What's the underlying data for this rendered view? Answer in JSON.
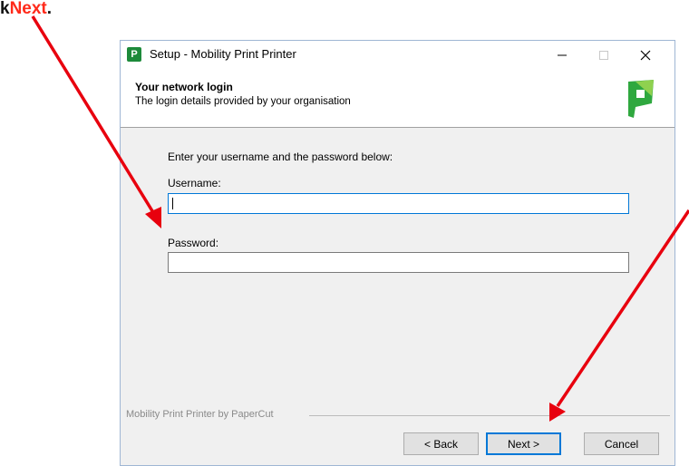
{
  "callout": {
    "prefix": "k ",
    "highlight": "Next",
    "suffix": "."
  },
  "window": {
    "title": "Setup - Mobility Print Printer",
    "icon_letter": "P",
    "controls": [
      "minimize-icon",
      "maximize-icon",
      "close-icon"
    ]
  },
  "header": {
    "title": "Your network login",
    "subtitle": "The login details provided by your organisation"
  },
  "form": {
    "instructions": "Enter your username and the password below:",
    "username_label": "Username:",
    "username_value": "",
    "password_label": "Password:",
    "password_value": ""
  },
  "footer": {
    "branding": "Mobility Print Printer by PaperCut",
    "back_label": "< Back",
    "next_label": "Next >",
    "cancel_label": "Cancel"
  },
  "colors": {
    "arrow": "#e8000e",
    "accent": "#0078d7",
    "logo_green": "#2fa83f"
  }
}
